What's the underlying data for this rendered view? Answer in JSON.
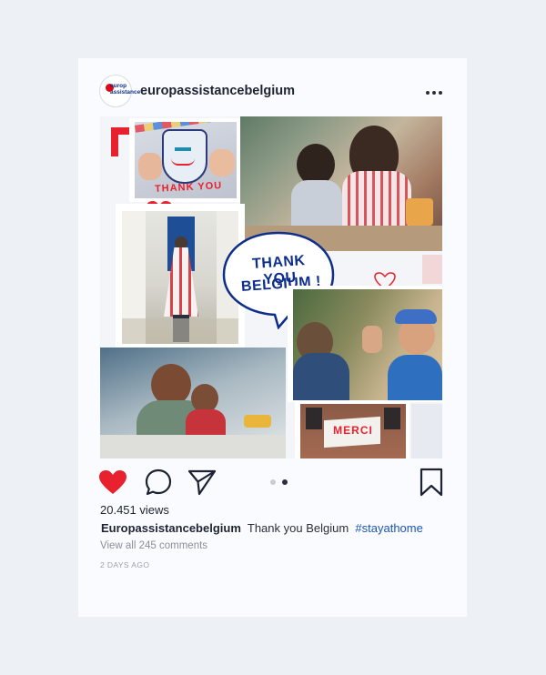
{
  "post": {
    "username": "europassistancebelgium",
    "avatar_text": "europ assistance",
    "collage": {
      "drawing_text": "THANK YOU",
      "bubble_line1": "THANK YOU",
      "bubble_line2": "BELGIUM !",
      "banner_text": "MERCI"
    },
    "actions": {
      "like_icon": "heart-icon",
      "comment_icon": "comment-icon",
      "share_icon": "send-icon",
      "save_icon": "bookmark-icon",
      "carousel_active_index": 1,
      "carousel_count": 2
    },
    "views": "20.451 views",
    "caption_user": "Europassistancebelgium",
    "caption_text": "Thank you  Belgium",
    "caption_hashtag": "#stayathome",
    "view_comments": "View all 245 comments",
    "timestamp": "2 DAYS AGO"
  },
  "colors": {
    "background": "#edf0f5",
    "card": "#fafbfe",
    "accent_red": "#e8212f",
    "brand_blue": "#0d2e8a",
    "hashtag": "#1a56b8"
  }
}
